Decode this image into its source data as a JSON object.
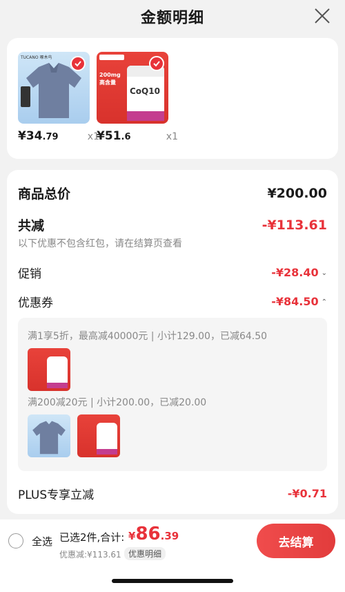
{
  "header": {
    "title": "金额明细"
  },
  "products": [
    {
      "price_int": "¥34",
      "price_dec": ".79",
      "qty": "x1",
      "brand": "TUCANO 啄木鸟",
      "type": "shirt"
    },
    {
      "price_int": "¥51",
      "price_dec": ".6",
      "qty": "x1",
      "badge_text": "200mg 高含量",
      "product_label": "CoQ10",
      "type": "coq10"
    }
  ],
  "summary": {
    "total_label": "商品总价",
    "total_value": "¥200.00",
    "reduce_label": "共减",
    "reduce_value": "-¥113.61",
    "reduce_note": "以下优惠不包含红包，请在结算页查看",
    "promo_label": "促销",
    "promo_value": "-¥28.40",
    "coupon_label": "优惠券",
    "coupon_value": "-¥84.50",
    "coupon_rules": [
      {
        "text": "满1享5折，最高减40000元 | 小计129.00，已减64.50"
      },
      {
        "text": "满200减20元 | 小计200.00，已减20.00"
      }
    ],
    "plus_label": "PLUS专享立减",
    "plus_value": "-¥0.71"
  },
  "bottom_bar": {
    "select_all": "全选",
    "selected_count": "已选2件,合计:",
    "total_yen": "¥",
    "total_int": "86",
    "total_dec": ".39",
    "discount_line": "优惠减:¥113.61",
    "detail_tag": "优惠明细",
    "checkout_label": "去结算"
  },
  "colors": {
    "accent": "#e8323a",
    "background": "#f2f2f2"
  }
}
